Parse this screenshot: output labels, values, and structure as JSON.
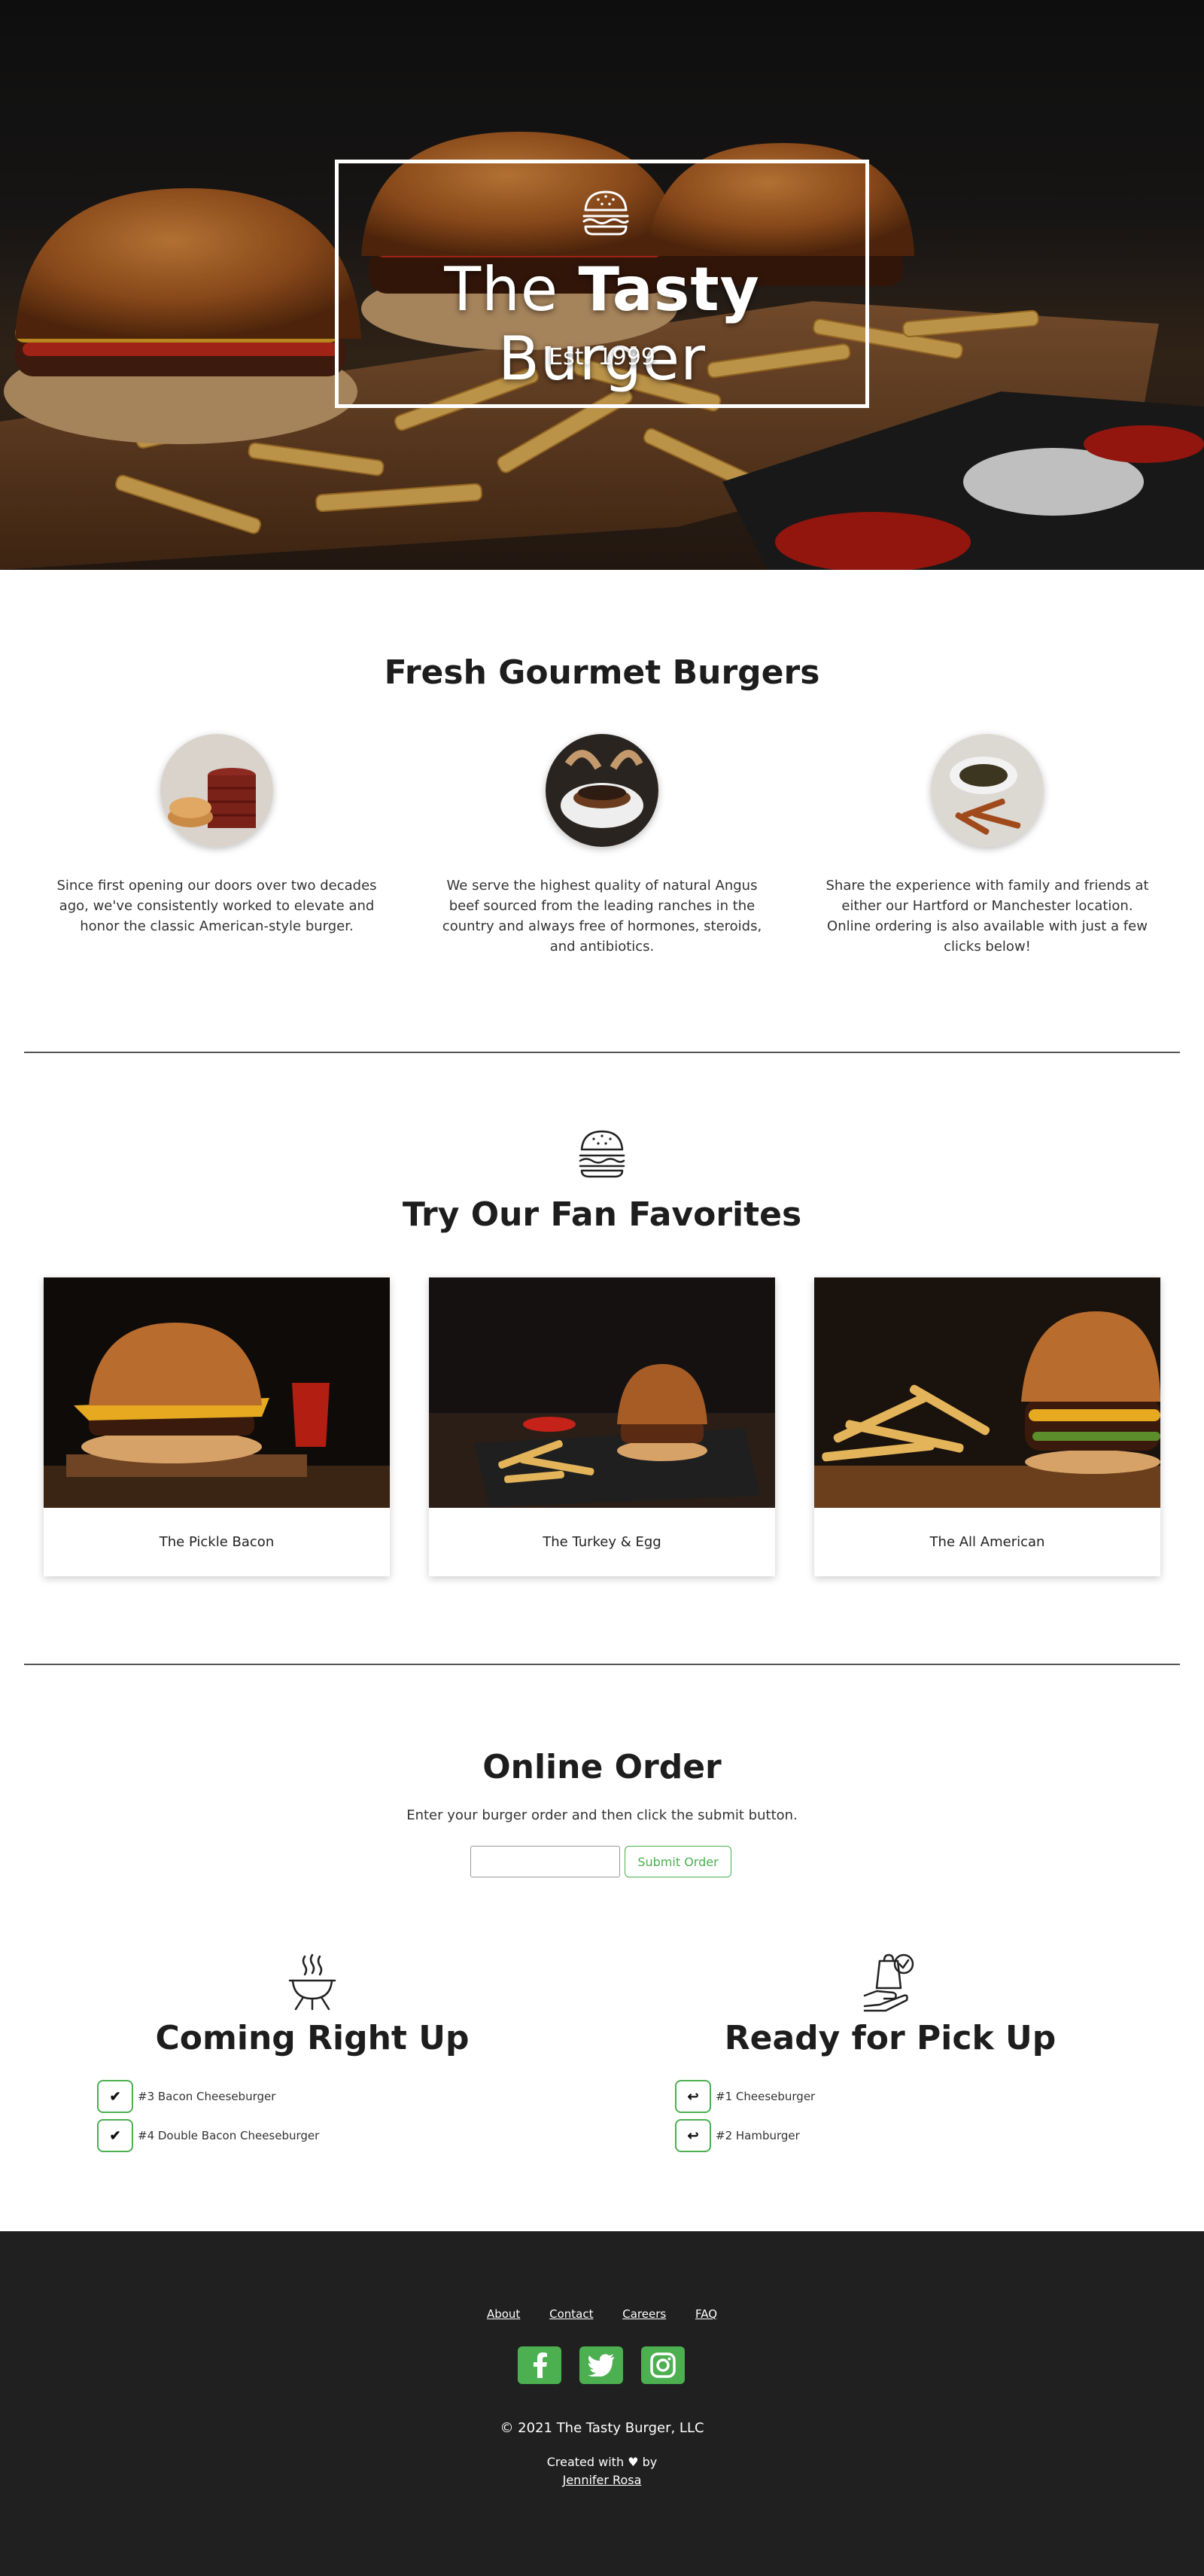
{
  "hero": {
    "title_pre": "The ",
    "title_bold": "Tasty",
    "title_post": " Burger",
    "established": "Est. 1999"
  },
  "intro": {
    "title": "Fresh Gourmet Burgers",
    "features": [
      {
        "text": "Since first opening our doors over two decades ago, we've consistently worked to elevate and honor the classic American-style burger."
      },
      {
        "text": "We serve the highest quality of natural Angus beef sourced from the leading ranches in the country and always free of hormones, steroids, and antibiotics."
      },
      {
        "text": "Share the experience with family and friends at either our Hartford or Manchester location. Online ordering is also available with just a few clicks below!"
      }
    ]
  },
  "favorites": {
    "title": "Try Our Fan Favorites",
    "items": [
      {
        "name": "The Pickle Bacon"
      },
      {
        "name": "The Turkey & Egg"
      },
      {
        "name": "The All American"
      }
    ]
  },
  "order": {
    "title": "Online Order",
    "instructions": "Enter your burger order and then click the submit button.",
    "input_value": "",
    "submit_label": "Submit Order"
  },
  "queues": {
    "coming": {
      "title": "Coming Right Up",
      "icon": "grill-icon",
      "items": [
        {
          "label": "#3 Bacon Cheeseburger",
          "action_symbol": "✔"
        },
        {
          "label": "#4 Double Bacon Cheeseburger",
          "action_symbol": "✔"
        }
      ]
    },
    "ready": {
      "title": "Ready for Pick Up",
      "icon": "pickup-bag-icon",
      "items": [
        {
          "label": "#1 Cheeseburger",
          "action_symbol": "↩"
        },
        {
          "label": "#2 Hamburger",
          "action_symbol": "↩"
        }
      ]
    }
  },
  "footer": {
    "links": [
      "About",
      "Contact",
      "Careers",
      "FAQ"
    ],
    "socials": [
      "facebook-icon",
      "twitter-icon",
      "instagram-icon"
    ],
    "copyright": "© 2021 The Tasty Burger, LLC",
    "created_prefix": "Created with",
    "created_by": "by",
    "author": "Jennifer Rosa"
  },
  "colors": {
    "accent": "#4caf50",
    "footer_bg": "#202020",
    "heading": "#1d1d1d"
  }
}
